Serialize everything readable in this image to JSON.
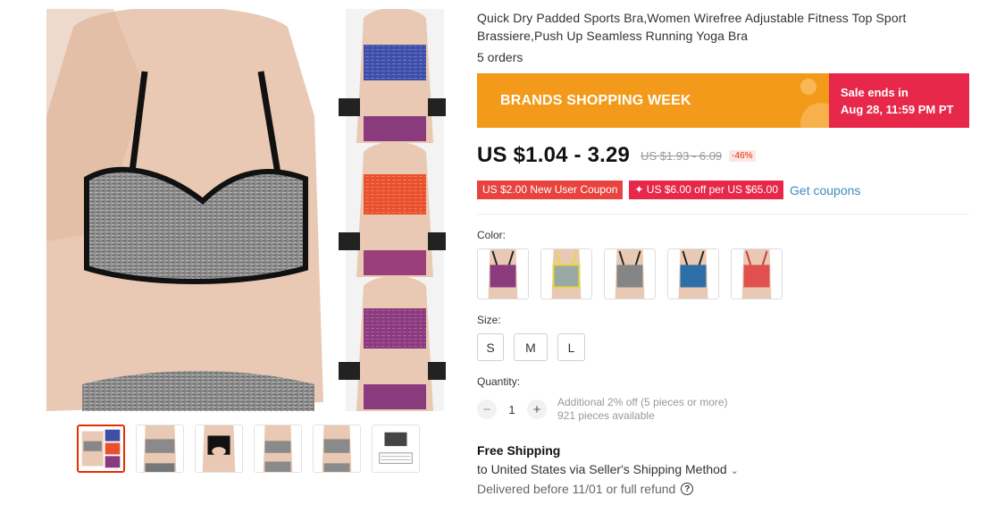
{
  "product": {
    "title": "Quick Dry Padded Sports Bra,Women Wirefree Adjustable Fitness Top Sport Brassiere,Push Up Seamless Running Yoga Bra",
    "orders": "5 orders"
  },
  "banner": {
    "promo": "BRANDS SHOPPING WEEK",
    "sale_line1": "Sale ends in",
    "sale_line2": "Aug 28, 11:59 PM PT",
    "colors": {
      "orange": "#f39a1b",
      "red": "#e8284a"
    }
  },
  "pricing": {
    "price": "US $1.04 - 3.29",
    "original": "US $1.93 - 6.09",
    "discount": "-46%"
  },
  "coupons": {
    "new_user": "US $2.00 New User Coupon",
    "store": "✦ US $6.00 off per US $65.00",
    "get_link": "Get coupons"
  },
  "options": {
    "color_label": "Color:",
    "color_variants": [
      "purple-heather",
      "yellow-grey",
      "grey-heather",
      "blue-heather",
      "red-heather"
    ],
    "size_label": "Size:",
    "sizes": [
      "S",
      "M",
      "L"
    ]
  },
  "quantity": {
    "label": "Quantity:",
    "minus": "−",
    "value": "1",
    "plus": "+",
    "bulk_note": "Additional 2% off (5 pieces or more)",
    "available": "921 pieces available"
  },
  "shipping": {
    "title": "Free Shipping",
    "destination": "to United States via Seller's Shipping Method",
    "dropdown_icon": "chevron-down-icon",
    "delivery": "Delivered before 11/01 or full refund",
    "help_icon_glyph": "?"
  },
  "gallery": {
    "thumbnail_count": 6,
    "active_index": 0
  }
}
